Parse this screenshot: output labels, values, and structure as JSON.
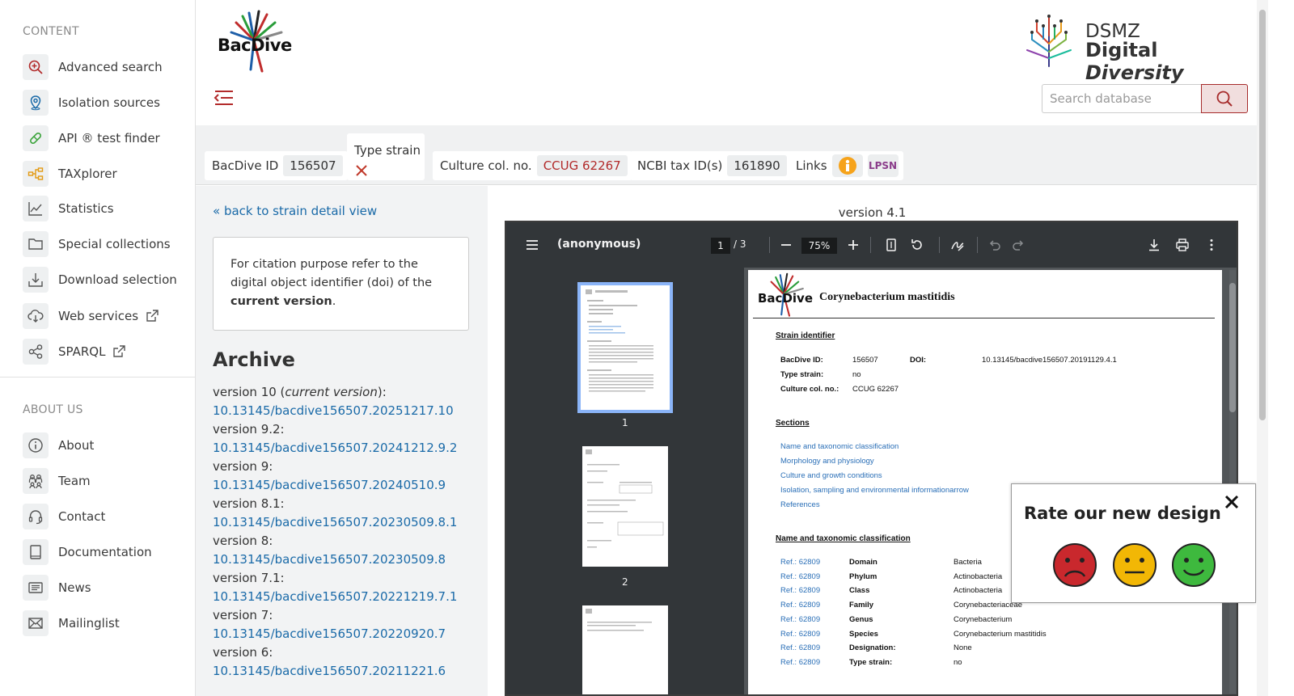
{
  "sidebar": {
    "content_heading": "CONTENT",
    "content_items": [
      {
        "label": "Advanced search",
        "icon": "search-plus-icon"
      },
      {
        "label": "Isolation sources",
        "icon": "location-pin-icon"
      },
      {
        "label": "API ® test finder",
        "icon": "pill-icon"
      },
      {
        "label": "TAXplorer",
        "icon": "hierarchy-icon"
      },
      {
        "label": "Statistics",
        "icon": "line-chart-icon"
      },
      {
        "label": "Special collections",
        "icon": "folder-icon"
      },
      {
        "label": "Download selection",
        "icon": "download-tray-icon"
      },
      {
        "label": "Web services",
        "icon": "cloud-download-icon"
      },
      {
        "label": "SPARQL",
        "icon": "share-nodes-icon"
      }
    ],
    "about_heading": "ABOUT US",
    "about_items": [
      {
        "label": "About",
        "icon": "info-icon"
      },
      {
        "label": "Team",
        "icon": "team-icon"
      },
      {
        "label": "Contact",
        "icon": "headset-icon"
      },
      {
        "label": "Documentation",
        "icon": "book-icon"
      },
      {
        "label": "News",
        "icon": "newspaper-icon"
      },
      {
        "label": "Mailinglist",
        "icon": "envelope-icon"
      }
    ]
  },
  "header": {
    "logo_text": "BacDive",
    "dsmz_line1": "DSMZ",
    "dsmz_line2a": "Digital",
    "dsmz_line2b": "Diversity",
    "search_placeholder": "Search database"
  },
  "infobar": {
    "bacdive_id_label": "BacDive ID",
    "bacdive_id": "156507",
    "type_strain_label": "Type strain",
    "culture_label": "Culture col. no.",
    "culture_value": "CCUG 62267",
    "ncbi_label": "NCBI tax ID(s)",
    "ncbi_value": "161890",
    "links_label": "Links",
    "lpsn": "LPSN"
  },
  "left": {
    "back_link": "« back to strain detail view",
    "cite_pre": "For citation purpose refer to the digital object identifier (doi) of the ",
    "cite_bold": "current version",
    "cite_post": ".",
    "archive_title": "Archive",
    "versions": [
      {
        "label_pre": "version 10 (",
        "label_em": "current version",
        "label_post": "):",
        "doi": "10.13145/bacdive156507.20251217.10"
      },
      {
        "label_pre": "version 9.2:",
        "label_em": "",
        "label_post": "",
        "doi": "10.13145/bacdive156507.20241212.9.2"
      },
      {
        "label_pre": "version 9:",
        "label_em": "",
        "label_post": "",
        "doi": "10.13145/bacdive156507.20240510.9"
      },
      {
        "label_pre": "version 8.1:",
        "label_em": "",
        "label_post": "",
        "doi": "10.13145/bacdive156507.20230509.8.1"
      },
      {
        "label_pre": "version 8:",
        "label_em": "",
        "label_post": "",
        "doi": "10.13145/bacdive156507.20230509.8"
      },
      {
        "label_pre": "version 7.1:",
        "label_em": "",
        "label_post": "",
        "doi": "10.13145/bacdive156507.20221219.7.1"
      },
      {
        "label_pre": "version 7:",
        "label_em": "",
        "label_post": "",
        "doi": "10.13145/bacdive156507.20220920.7"
      },
      {
        "label_pre": "version 6:",
        "label_em": "",
        "label_post": "",
        "doi": "10.13145/bacdive156507.20211221.6"
      }
    ]
  },
  "viewer": {
    "version_label": "version 4.1",
    "doc_name": "(anonymous)",
    "page": "1",
    "page_count": "/ 3",
    "zoom": "75%",
    "thumb_numbers": [
      "1",
      "2"
    ],
    "pdf": {
      "title": "Corynebacterium mastitidis",
      "strain_identifier": "Strain identifier",
      "bacdive_id_label": "BacDive ID:",
      "bacdive_id": "156507",
      "doi_label": "DOI:",
      "doi": "10.13145/bacdive156507.20191129.4.1",
      "type_strain_label": "Type strain:",
      "type_strain": "no",
      "culture_label": "Culture col. no.:",
      "culture": "CCUG 62267",
      "sections_heading": "Sections",
      "sections": [
        "Name and taxonomic classification",
        "Morphology and physiology",
        "Culture and growth conditions",
        "Isolation, sampling and environmental informationarrow",
        "References"
      ],
      "taxo_heading": "Name and taxonomic classification",
      "taxo_rows": [
        {
          "ref": "Ref.: 62809",
          "key": "Domain",
          "val": "Bacteria"
        },
        {
          "ref": "Ref.: 62809",
          "key": "Phylum",
          "val": "Actinobacteria"
        },
        {
          "ref": "Ref.: 62809",
          "key": "Class",
          "val": "Actinobacteria"
        },
        {
          "ref": "Ref.: 62809",
          "key": "Family",
          "val": "Corynebacteriaceae"
        },
        {
          "ref": "Ref.: 62809",
          "key": "Genus",
          "val": "Corynebacterium"
        },
        {
          "ref": "Ref.: 62809",
          "key": "Species",
          "val": "Corynebacterium mastitidis"
        },
        {
          "ref": "Ref.: 62809",
          "key": "Designation:",
          "val": "None"
        },
        {
          "ref": "Ref.: 62809",
          "key": "Type strain:",
          "val": "no"
        }
      ]
    }
  },
  "rating": {
    "title": "Rate our new design",
    "faces": [
      "sad-face-icon",
      "neutral-face-icon",
      "happy-face-icon"
    ]
  },
  "colors": {
    "accent_red": "#a62a2a",
    "link_blue": "#1a6aa8",
    "sad": "#c9282d",
    "neutral": "#f2b705",
    "happy": "#3eb93e"
  }
}
